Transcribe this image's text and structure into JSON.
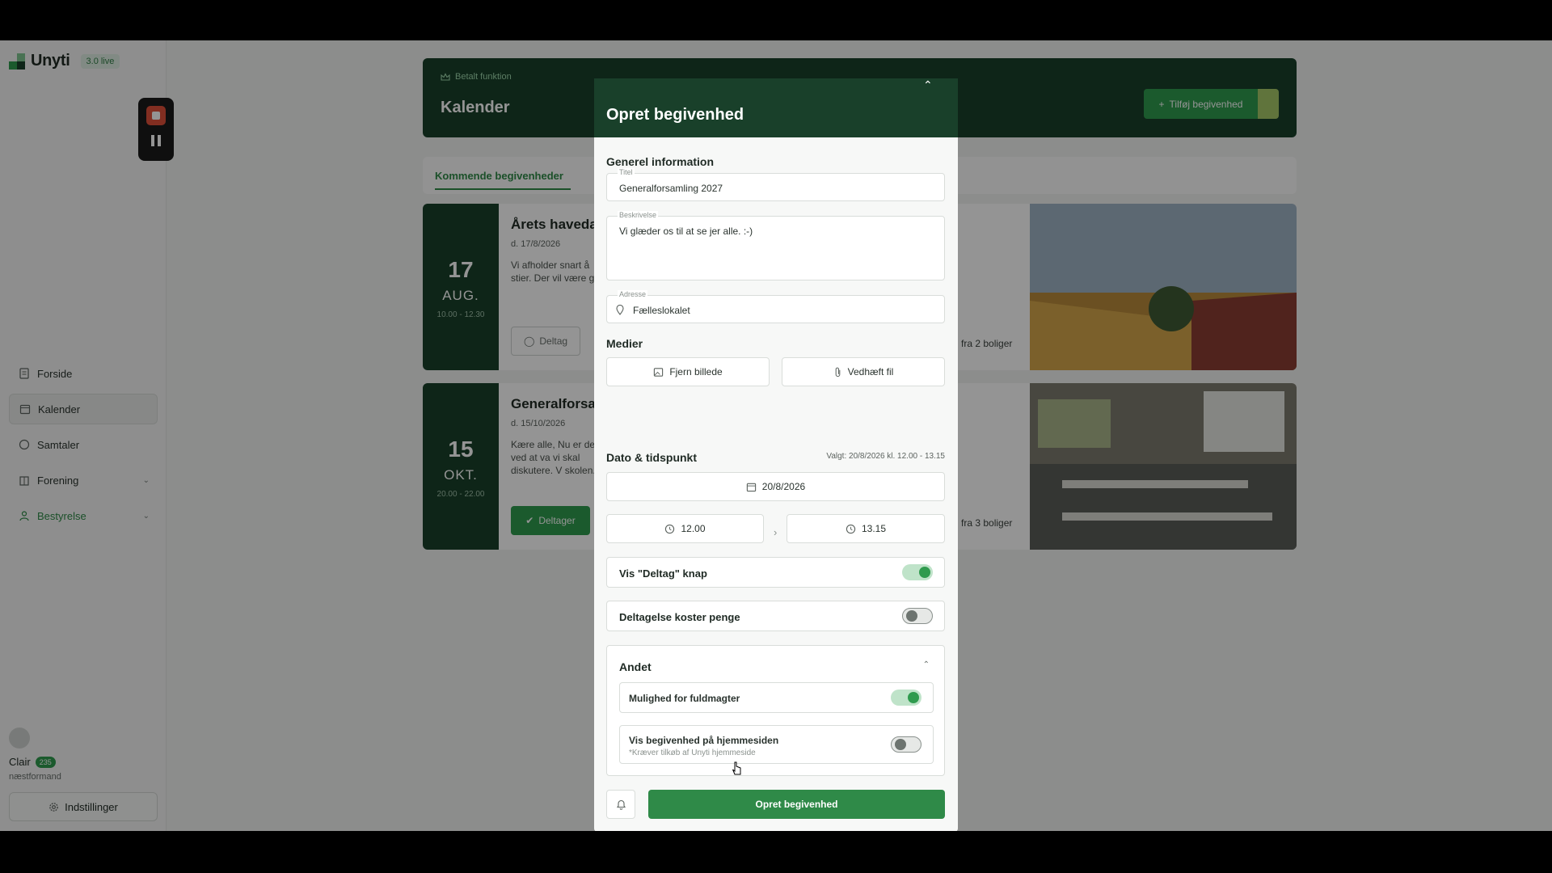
{
  "app": {
    "name": "Unyti",
    "version_badge": "3.0 live"
  },
  "sidebar": {
    "items": [
      {
        "label": "Forside"
      },
      {
        "label": "Kalender"
      },
      {
        "label": "Samtaler"
      },
      {
        "label": "Forening"
      },
      {
        "label": "Bestyrelse"
      }
    ],
    "user": {
      "name": "Clair",
      "badge": "235",
      "role": "næstformand"
    },
    "settings_label": "Indstillinger"
  },
  "header": {
    "tag": "Betalt funktion",
    "title": "Kalender",
    "add_event_label": "Tilføj begivenhed"
  },
  "tabs": {
    "active": "Kommende begivenheder"
  },
  "events": [
    {
      "day": "17",
      "month": "AUG.",
      "time": "10.00 - 12.30",
      "title": "Årets havedag",
      "date": "d. 17/8/2026",
      "desc": "Vi afholder snart å stier. Der vil være g",
      "button": "Deltag",
      "count": "fra 2 boliger"
    },
    {
      "day": "15",
      "month": "OKT.",
      "time": "20.00 - 22.00",
      "title": "Generalforsamling",
      "date": "d. 15/10/2026",
      "desc": "Kære alle, Nu er det ved at va vi skal diskutere. V skolen.",
      "button": "Deltager",
      "count": "fra 3 boliger"
    }
  ],
  "modal": {
    "title": "Opret begivenhed",
    "general_section": "Generel information",
    "title_field": {
      "label": "Titel",
      "value": "Generalforsamling 2027"
    },
    "description_field": {
      "label": "Beskrivelse",
      "value": "Vi glæder os til at se jer alle. :-)"
    },
    "address_field": {
      "label": "Adresse",
      "value": "Fælleslokalet"
    },
    "media_section": "Medier",
    "remove_image_label": "Fjern billede",
    "attach_file_label": "Vedhæft fil",
    "datetime_section": "Dato & tidspunkt",
    "selected_info": "Valgt: 20/8/2026 kl. 12.00 - 13.15",
    "date_value": "20/8/2026",
    "start_time": "12.00",
    "end_time": "13.15",
    "toggle_participate": {
      "label": "Vis \"Deltag\" knap",
      "on": true
    },
    "toggle_costs": {
      "label": "Deltagelse koster penge",
      "on": false
    },
    "other_section": "Andet",
    "toggle_proxies": {
      "label": "Mulighed for fuldmagter",
      "on": true
    },
    "toggle_website": {
      "label": "Vis begivenhed på hjemmesiden",
      "note": "*Kræver tilkøb af Unyti hjemmeside",
      "on": false
    },
    "submit_label": "Opret begivenhed"
  },
  "colors": {
    "primary_dark": "#19402a",
    "primary": "#2f9b4e",
    "accent_lime": "#a6c868"
  }
}
